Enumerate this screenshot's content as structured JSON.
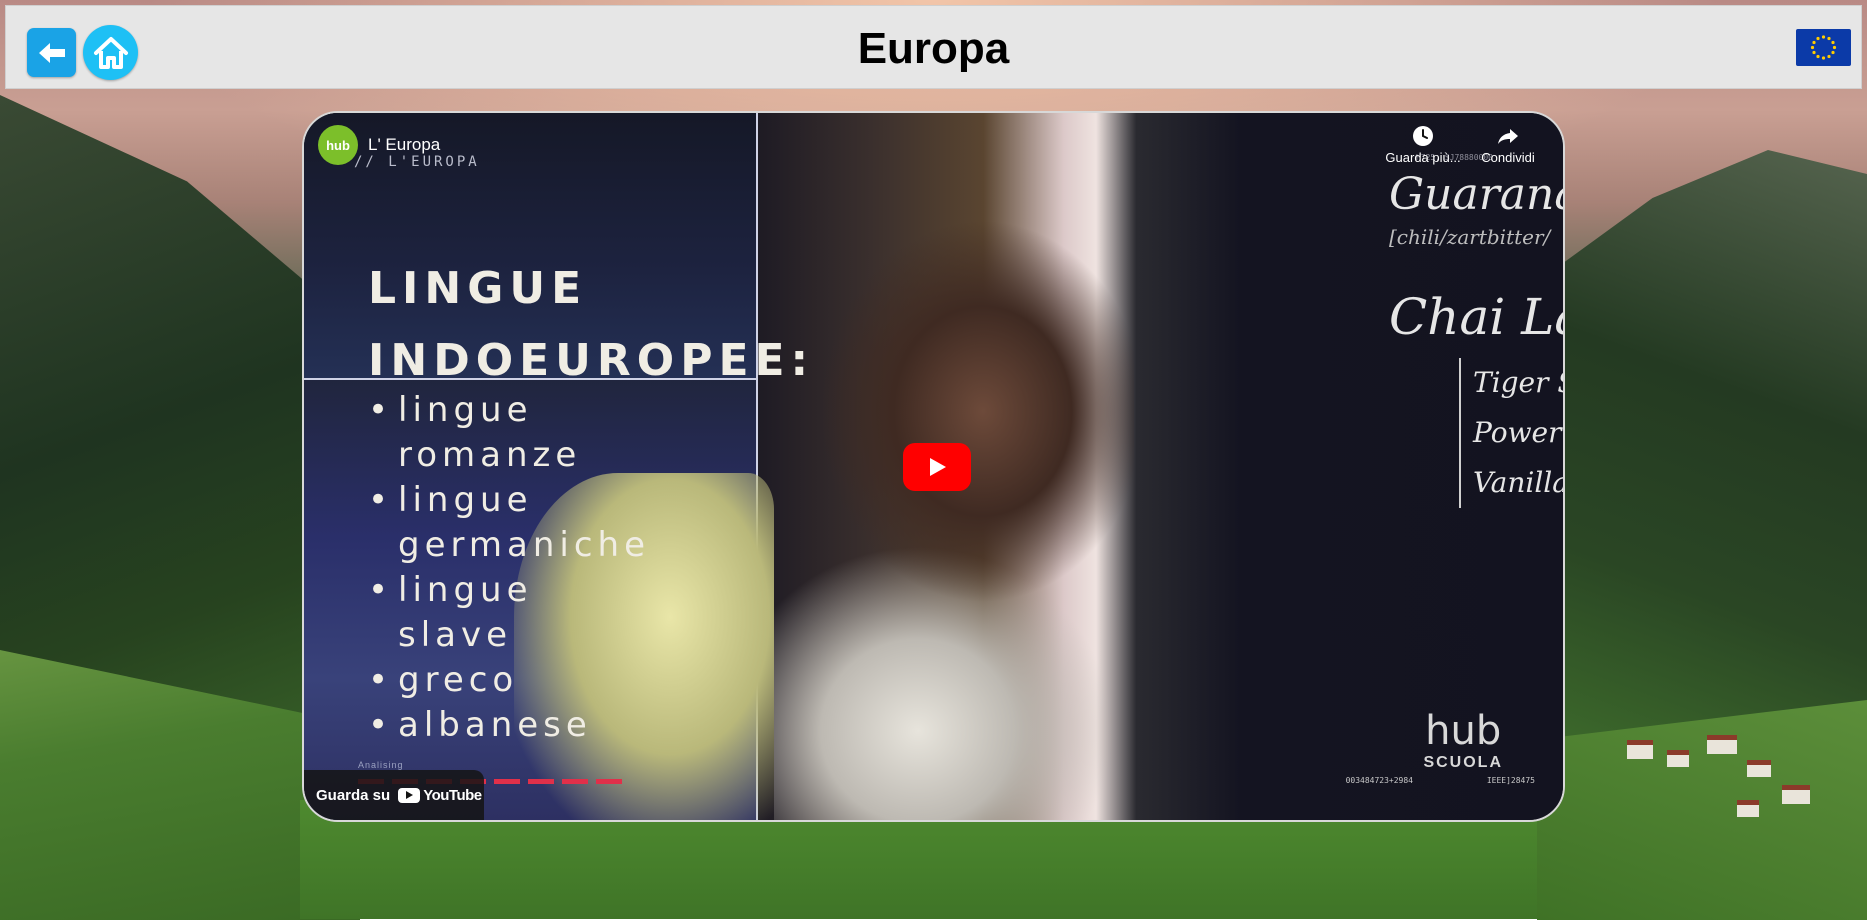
{
  "header": {
    "title": "Europa",
    "back_icon": "arrow-left-icon",
    "home_icon": "home-icon",
    "flag_icon": "eu-flag-icon"
  },
  "video": {
    "channel_logo": "hub",
    "title": "L' Europa",
    "subtitle": "// L'EUROPA",
    "watch_later_label": "Guarda più...",
    "share_label": "Condividi",
    "watch_on_label": "Guarda su",
    "youtube_label": "YouTube",
    "play_icon": "play-icon",
    "slide": {
      "heading_line1": "LINGUE",
      "heading_line2": "INDOEUROPEE:",
      "items": [
        [
          "lingue",
          "romanze"
        ],
        [
          "lingue",
          "germaniche"
        ],
        [
          "lingue",
          "slave"
        ],
        [
          "greco"
        ],
        [
          "albanese"
        ]
      ],
      "caption": "Analising"
    },
    "chalkboard": {
      "line1": "Guarana",
      "line2": "[chili/zartbitter/",
      "line3": "Chai Latte",
      "items": [
        "Tiger Spice",
        "Power Chai",
        "Vanilla Chai"
      ]
    },
    "brand": {
      "hub": "hub",
      "school": "SCUOLA",
      "code_left": "003484723+2984",
      "code_right": "IEEE]28475",
      "code_top": "H725, SJ78880000"
    }
  },
  "colors": {
    "header_bg": "#e6e6e6",
    "back_button": "#1aa3e6",
    "home_button": "#1ec0f5",
    "play_button": "#ff0000",
    "progress": "#e0304a"
  }
}
